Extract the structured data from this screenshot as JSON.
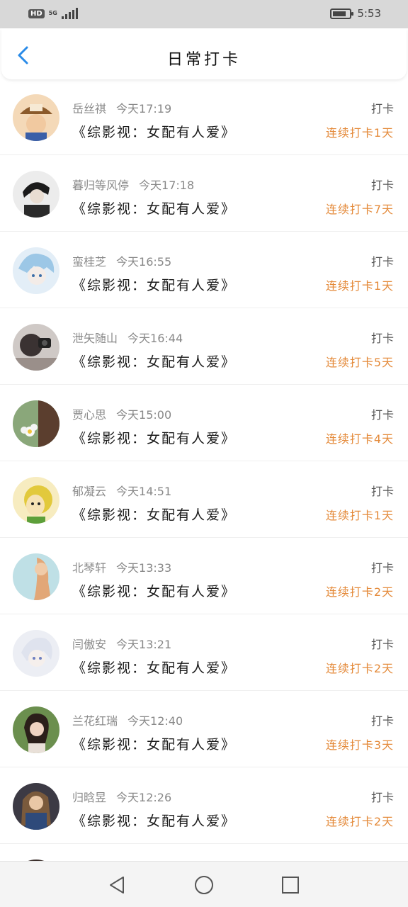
{
  "status_bar": {
    "network_badge": "HD",
    "network_type": "5G",
    "time": "5:53"
  },
  "header": {
    "title": "日常打卡"
  },
  "common": {
    "checkin_label": "打卡"
  },
  "entries": [
    {
      "name": "岳丝祺",
      "time": "今天17:19",
      "book": "《综影视：女配有人爱》",
      "streak": "连续打卡1天"
    },
    {
      "name": "暮归等风停",
      "time": "今天17:18",
      "book": "《综影视：女配有人爱》",
      "streak": "连续打卡7天"
    },
    {
      "name": "蛮桂芝",
      "time": "今天16:55",
      "book": "《综影视：女配有人爱》",
      "streak": "连续打卡1天"
    },
    {
      "name": "泄矢随山",
      "time": "今天16:44",
      "book": "《综影视：女配有人爱》",
      "streak": "连续打卡5天"
    },
    {
      "name": "贾心思",
      "time": "今天15:00",
      "book": "《综影视：女配有人爱》",
      "streak": "连续打卡4天"
    },
    {
      "name": "郁凝云",
      "time": "今天14:51",
      "book": "《综影视：女配有人爱》",
      "streak": "连续打卡1天"
    },
    {
      "name": "北琴轩",
      "time": "今天13:33",
      "book": "《综影视：女配有人爱》",
      "streak": "连续打卡2天"
    },
    {
      "name": "闫傲安",
      "time": "今天13:21",
      "book": "《综影视：女配有人爱》",
      "streak": "连续打卡2天"
    },
    {
      "name": "兰花红瑞",
      "time": "今天12:40",
      "book": "《综影视：女配有人爱》",
      "streak": "连续打卡3天"
    },
    {
      "name": "归晗昱",
      "time": "今天12:26",
      "book": "《综影视：女配有人爱》",
      "streak": "连续打卡2天"
    }
  ],
  "colors": {
    "accent": "#e48a3a",
    "back_icon": "#2a8be8"
  },
  "icons": {
    "back": "chevron-left-icon",
    "nav_back": "triangle-back-icon",
    "nav_home": "circle-home-icon",
    "nav_recents": "square-recents-icon"
  }
}
